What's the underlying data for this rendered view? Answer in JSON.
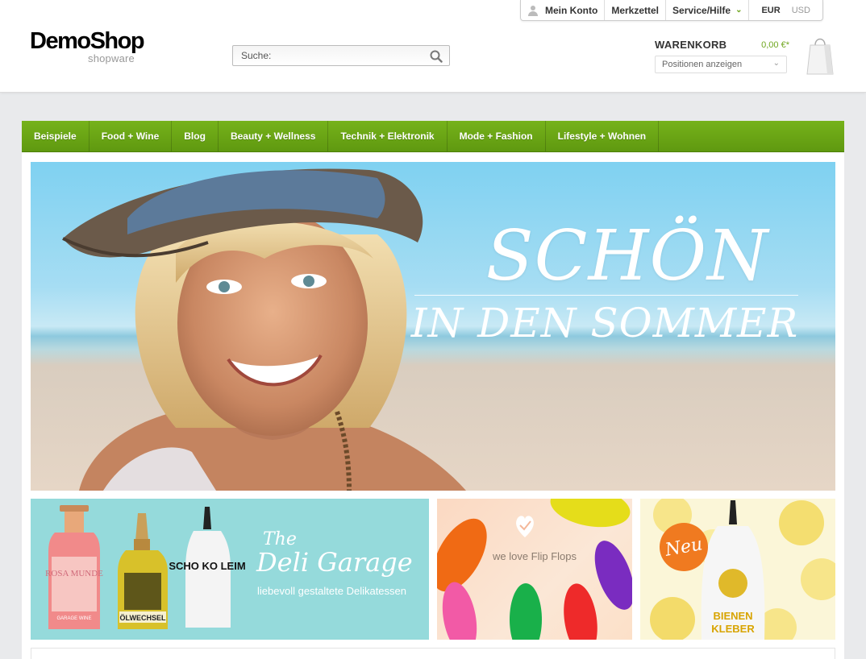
{
  "brand": {
    "name": "DemoShop",
    "sub": "shopware"
  },
  "topbar": {
    "account": "Mein Konto",
    "wishlist": "Merkzettel",
    "service": "Service/Hilfe",
    "currency_active": "EUR",
    "currency_other": "USD"
  },
  "search": {
    "placeholder": "Suche:"
  },
  "cart": {
    "title": "WARENKORB",
    "amount": "0,00 €*",
    "select_label": "Positionen anzeigen"
  },
  "nav": {
    "items": [
      "Beispiele",
      "Food + Wine",
      "Blog",
      "Beauty + Wellness",
      "Technik + Elektronik",
      "Mode + Fashion",
      "Lifestyle + Wohnen"
    ]
  },
  "hero": {
    "line1": "SCHÖN",
    "line2": "IN DEN SOMMER"
  },
  "banners": {
    "deli": {
      "the": "The",
      "title": "Deli Garage",
      "subtitle": "liebevoll gestaltete Delikatessen",
      "bottle1_label": "ROSA MUNDE",
      "bottle1_sub": "GARAGE WINE",
      "bottle2_label": "ÖLWECHSEL",
      "bottle3_label": "SCHO KO LEIM"
    },
    "flipflops": {
      "text": "we love Flip Flops"
    },
    "bienen": {
      "badge": "Neu",
      "label_line1": "BIENEN",
      "label_line2": "KLEBER"
    }
  },
  "colors": {
    "nav_green": "#6fa61e",
    "accent_orange": "#f07a20"
  }
}
